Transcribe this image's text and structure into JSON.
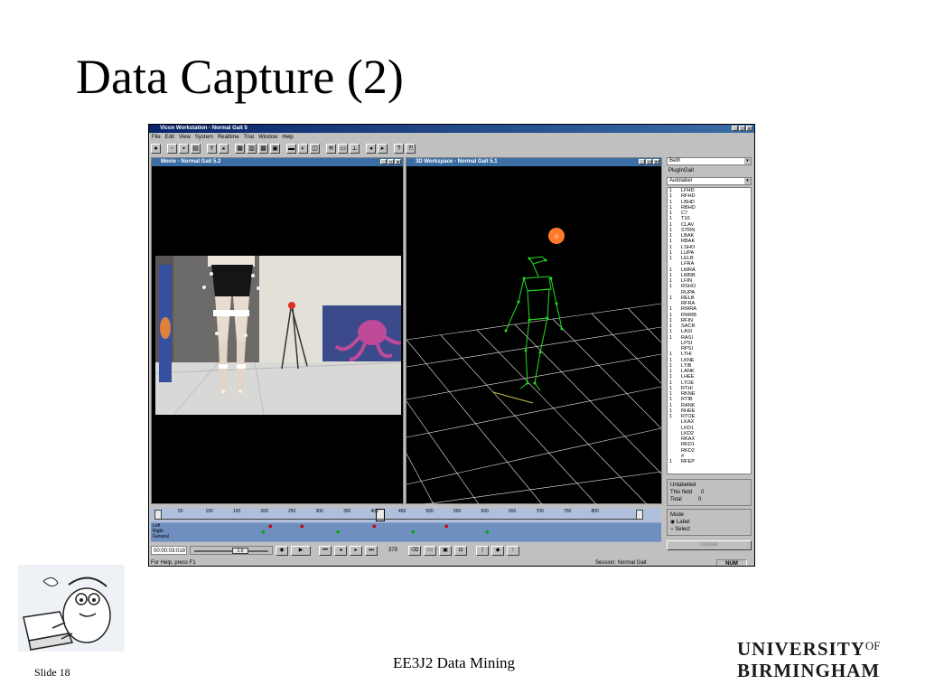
{
  "slide": {
    "title": "Data Capture (2)",
    "footer": "EE3J2 Data Mining",
    "slide_number": "Slide 18",
    "university_line1": "UNIVERSITY",
    "university_of": "OF",
    "university_line2": "BIRMINGHAM"
  },
  "app": {
    "window_title": "Vicon Workstation - Normal Gait 5",
    "menu": [
      "File",
      "Edit",
      "View",
      "System",
      "Realtime",
      "Trial",
      "Window",
      "Help"
    ],
    "movie_panel_title": "Movie - Normal Gait 5.2",
    "workspace_panel_title": "3D Workspace - Normal Gait 5.1",
    "subject_field": "Beth",
    "model_label": "PlugInGait",
    "autolabel_field": "Autolabel",
    "markers": [
      {
        "flag": "1",
        "name": "LFHD"
      },
      {
        "flag": "1",
        "name": "RFHD"
      },
      {
        "flag": "1",
        "name": "LBHD"
      },
      {
        "flag": "1",
        "name": "RBHD"
      },
      {
        "flag": "1",
        "name": "C7"
      },
      {
        "flag": "1",
        "name": "T10"
      },
      {
        "flag": "1",
        "name": "CLAV"
      },
      {
        "flag": "1",
        "name": "STRN"
      },
      {
        "flag": "1",
        "name": "LBAK"
      },
      {
        "flag": "1",
        "name": "RBAK"
      },
      {
        "flag": "1",
        "name": "LSHO"
      },
      {
        "flag": "1",
        "name": "LUPA"
      },
      {
        "flag": "1",
        "name": "LELB"
      },
      {
        "flag": "",
        "name": "LFRA"
      },
      {
        "flag": "1",
        "name": "LWRA"
      },
      {
        "flag": "1",
        "name": "LWRB"
      },
      {
        "flag": "1",
        "name": "LFIN"
      },
      {
        "flag": "1",
        "name": "RSHO"
      },
      {
        "flag": "",
        "name": "RUPA"
      },
      {
        "flag": "1",
        "name": "RELB"
      },
      {
        "flag": "",
        "name": "RFRA"
      },
      {
        "flag": "1",
        "name": "RWRA"
      },
      {
        "flag": "1",
        "name": "RWRB"
      },
      {
        "flag": "1",
        "name": "RFIN"
      },
      {
        "flag": "1",
        "name": "SACR"
      },
      {
        "flag": "1",
        "name": "LASI"
      },
      {
        "flag": "1",
        "name": "RASI"
      },
      {
        "flag": "",
        "name": "LPSI"
      },
      {
        "flag": "",
        "name": "RPSI"
      },
      {
        "flag": "1",
        "name": "LTHI"
      },
      {
        "flag": "1",
        "name": "LKNE"
      },
      {
        "flag": "1",
        "name": "LTIB"
      },
      {
        "flag": "1",
        "name": "LANK"
      },
      {
        "flag": "1",
        "name": "LHEE"
      },
      {
        "flag": "1",
        "name": "LTOE"
      },
      {
        "flag": "1",
        "name": "RTHI"
      },
      {
        "flag": "1",
        "name": "RKNE"
      },
      {
        "flag": "1",
        "name": "RTIB"
      },
      {
        "flag": "1",
        "name": "RANK"
      },
      {
        "flag": "1",
        "name": "RHEE"
      },
      {
        "flag": "1",
        "name": "RTOE"
      },
      {
        "flag": "",
        "name": "LKAX"
      },
      {
        "flag": "",
        "name": "LKD1"
      },
      {
        "flag": "",
        "name": "LKD2"
      },
      {
        "flag": "",
        "name": "RKAX"
      },
      {
        "flag": "",
        "name": "RKD1"
      },
      {
        "flag": "",
        "name": "RKD2"
      },
      {
        "flag": "",
        "name": "#"
      },
      {
        "flag": "1",
        "name": "RFEP"
      }
    ],
    "unlabelled_label": "Unlabelled",
    "this_field_label": "This field",
    "this_field_value": "0",
    "total_label": "Total",
    "total_value": "0",
    "mode_label": "Mode",
    "mode_label_option": "Label",
    "mode_select_option": "Select",
    "update_button": "Update",
    "timeline_ticks": [
      "50",
      "100",
      "150",
      "200",
      "250",
      "300",
      "350",
      "400",
      "450",
      "500",
      "550",
      "600",
      "650",
      "700",
      "750",
      "800"
    ],
    "track_labels": [
      "Left",
      "Right",
      "General"
    ],
    "time_display": "00:00:03:018",
    "speed_display": "1:0",
    "frame_display": "379",
    "status_help": "For Help, press F1",
    "status_session": "Session:  Normal Gait",
    "status_num": "NUM"
  },
  "colors": {
    "skeleton": "#22dd22",
    "origin_marker": "#ff7a2a",
    "title_bar": "#0a246a",
    "panel_title": "#3a6ea5"
  }
}
